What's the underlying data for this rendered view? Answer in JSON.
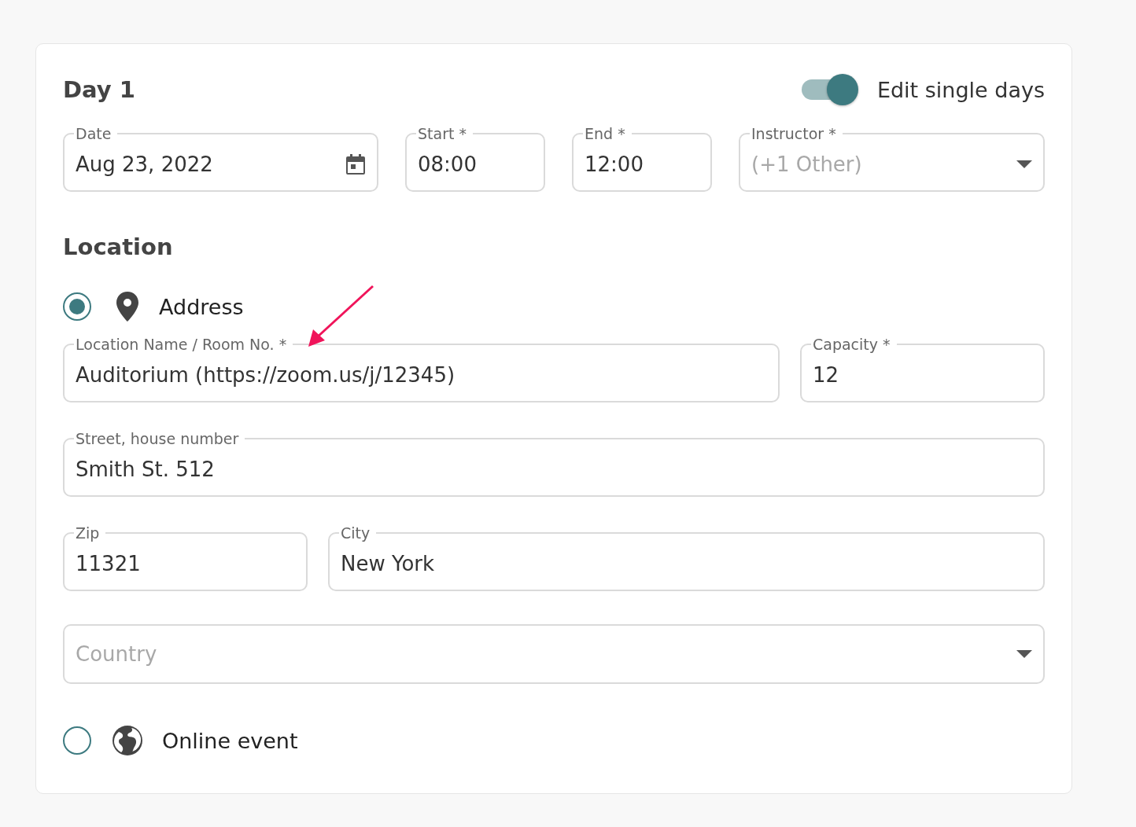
{
  "day": {
    "title": "Day 1",
    "edit_single_days": {
      "label": "Edit single days",
      "on": true
    }
  },
  "schedule_fields": [
    {
      "kind": "date",
      "label": "Date",
      "value": "Aug 23, 2022"
    },
    {
      "kind": "text",
      "label": "Start *",
      "value": "08:00"
    },
    {
      "kind": "text",
      "label": "End *",
      "value": "12:00"
    },
    {
      "kind": "select",
      "label": "Instructor *",
      "placeholder": "(+1 Other)"
    }
  ],
  "location": {
    "title": "Location",
    "options": [
      {
        "kind": "address",
        "label": "Address",
        "selected": true
      },
      {
        "kind": "online",
        "label": "Online event",
        "selected": false
      }
    ],
    "address_rows": [
      [
        {
          "kind": "text",
          "label": "Location Name / Room No. *",
          "value": "Auditorium (https://zoom.us/j/12345)"
        },
        {
          "kind": "text",
          "label": "Capacity *",
          "value": "12"
        }
      ],
      [
        {
          "kind": "text",
          "label": "Street, house number",
          "value": "Smith St. 512"
        }
      ],
      [
        {
          "kind": "text",
          "label": "Zip",
          "value": "11321"
        },
        {
          "kind": "text",
          "label": "City",
          "value": "New York"
        }
      ],
      [
        {
          "kind": "select",
          "placeholder": "Country"
        }
      ]
    ]
  }
}
